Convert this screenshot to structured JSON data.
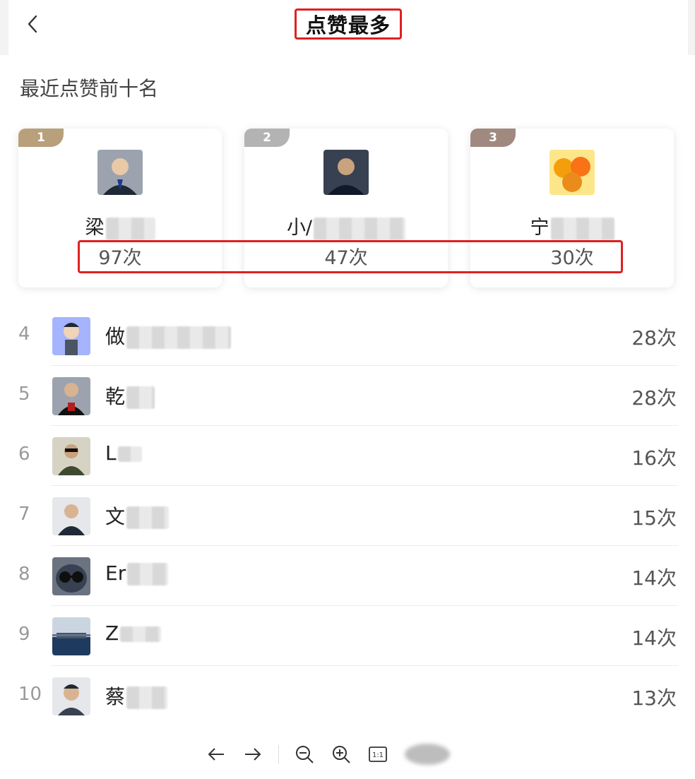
{
  "header": {
    "title": "点赞最多"
  },
  "section_title": "最近点赞前十名",
  "podium": [
    {
      "rank": "1",
      "name": "梁",
      "count": "97次",
      "badge_color": "#b8a07a",
      "avatar_colors": [
        "#6b7280",
        "#1f2937"
      ]
    },
    {
      "rank": "2",
      "name": "小/",
      "count": "47次",
      "badge_color": "#b3b3b3",
      "avatar_colors": [
        "#4b5563",
        "#111827"
      ]
    },
    {
      "rank": "3",
      "name": "宁",
      "count": "30次",
      "badge_color": "#a08a80",
      "avatar_colors": [
        "#f59e0b",
        "#c2410c"
      ]
    }
  ],
  "list": [
    {
      "rank": "4",
      "name": "做",
      "count": "28次",
      "avatar_colors": [
        "#a5b4fc",
        "#4b5563"
      ]
    },
    {
      "rank": "5",
      "name": "乾",
      "count": "28次",
      "avatar_colors": [
        "#9ca3af",
        "#111111"
      ]
    },
    {
      "rank": "6",
      "name": "L",
      "count": "16次",
      "avatar_colors": [
        "#d6d3c4",
        "#3f4a2f"
      ]
    },
    {
      "rank": "7",
      "name": "文",
      "count": "15次",
      "avatar_colors": [
        "#e5e7eb",
        "#1f2937"
      ]
    },
    {
      "rank": "8",
      "name": "Er",
      "count": "14次",
      "avatar_colors": [
        "#6b7280",
        "#0f0f0f"
      ]
    },
    {
      "rank": "9",
      "name": "Z",
      "count": "14次",
      "avatar_colors": [
        "#cbd5e1",
        "#1e3a5f"
      ]
    },
    {
      "rank": "10",
      "name": "蔡",
      "count": "13次",
      "avatar_colors": [
        "#e5e7eb",
        "#374151"
      ]
    }
  ],
  "toolbar": {
    "icons": [
      "arrow-left-icon",
      "arrow-right-icon",
      "zoom-out-icon",
      "zoom-in-icon",
      "actual-size-icon"
    ],
    "actual_size_label": "1:1"
  },
  "colors": {
    "highlight": "#e02020"
  }
}
